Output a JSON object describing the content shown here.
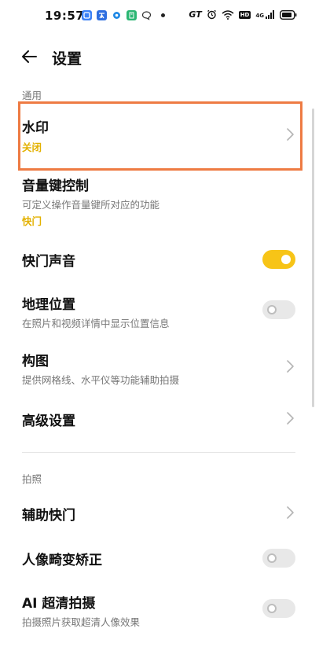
{
  "status_bar": {
    "time": "19:57",
    "carrier_badge": "GT",
    "hd_badge": "HD",
    "net_label": "4G"
  },
  "header": {
    "title": "设置"
  },
  "sections": {
    "general": "通用",
    "shooting": "拍照"
  },
  "rows": {
    "watermark": {
      "title": "水印",
      "value": "关闭"
    },
    "volume_key": {
      "title": "音量键控制",
      "subtitle": "可定义操作音量键所对应的功能",
      "value": "快门"
    },
    "shutter_sound": {
      "title": "快门声音",
      "toggle": "on"
    },
    "location": {
      "title": "地理位置",
      "subtitle": "在照片和视频详情中显示位置信息",
      "toggle": "off"
    },
    "composition": {
      "title": "构图",
      "subtitle": "提供网格线、水平仪等功能辅助拍摄"
    },
    "advanced": {
      "title": "高级设置"
    },
    "assist_shutter": {
      "title": "辅助快门"
    },
    "portrait_correction": {
      "title": "人像畸变矫正",
      "toggle": "off"
    },
    "ai_hd": {
      "title": "AI 超清拍摄",
      "subtitle": "拍摄照片获取超清人像效果",
      "toggle": "off"
    }
  },
  "colors": {
    "accent": "#f7c417",
    "value_text": "#e3b100",
    "highlight": "#ee7b43"
  }
}
